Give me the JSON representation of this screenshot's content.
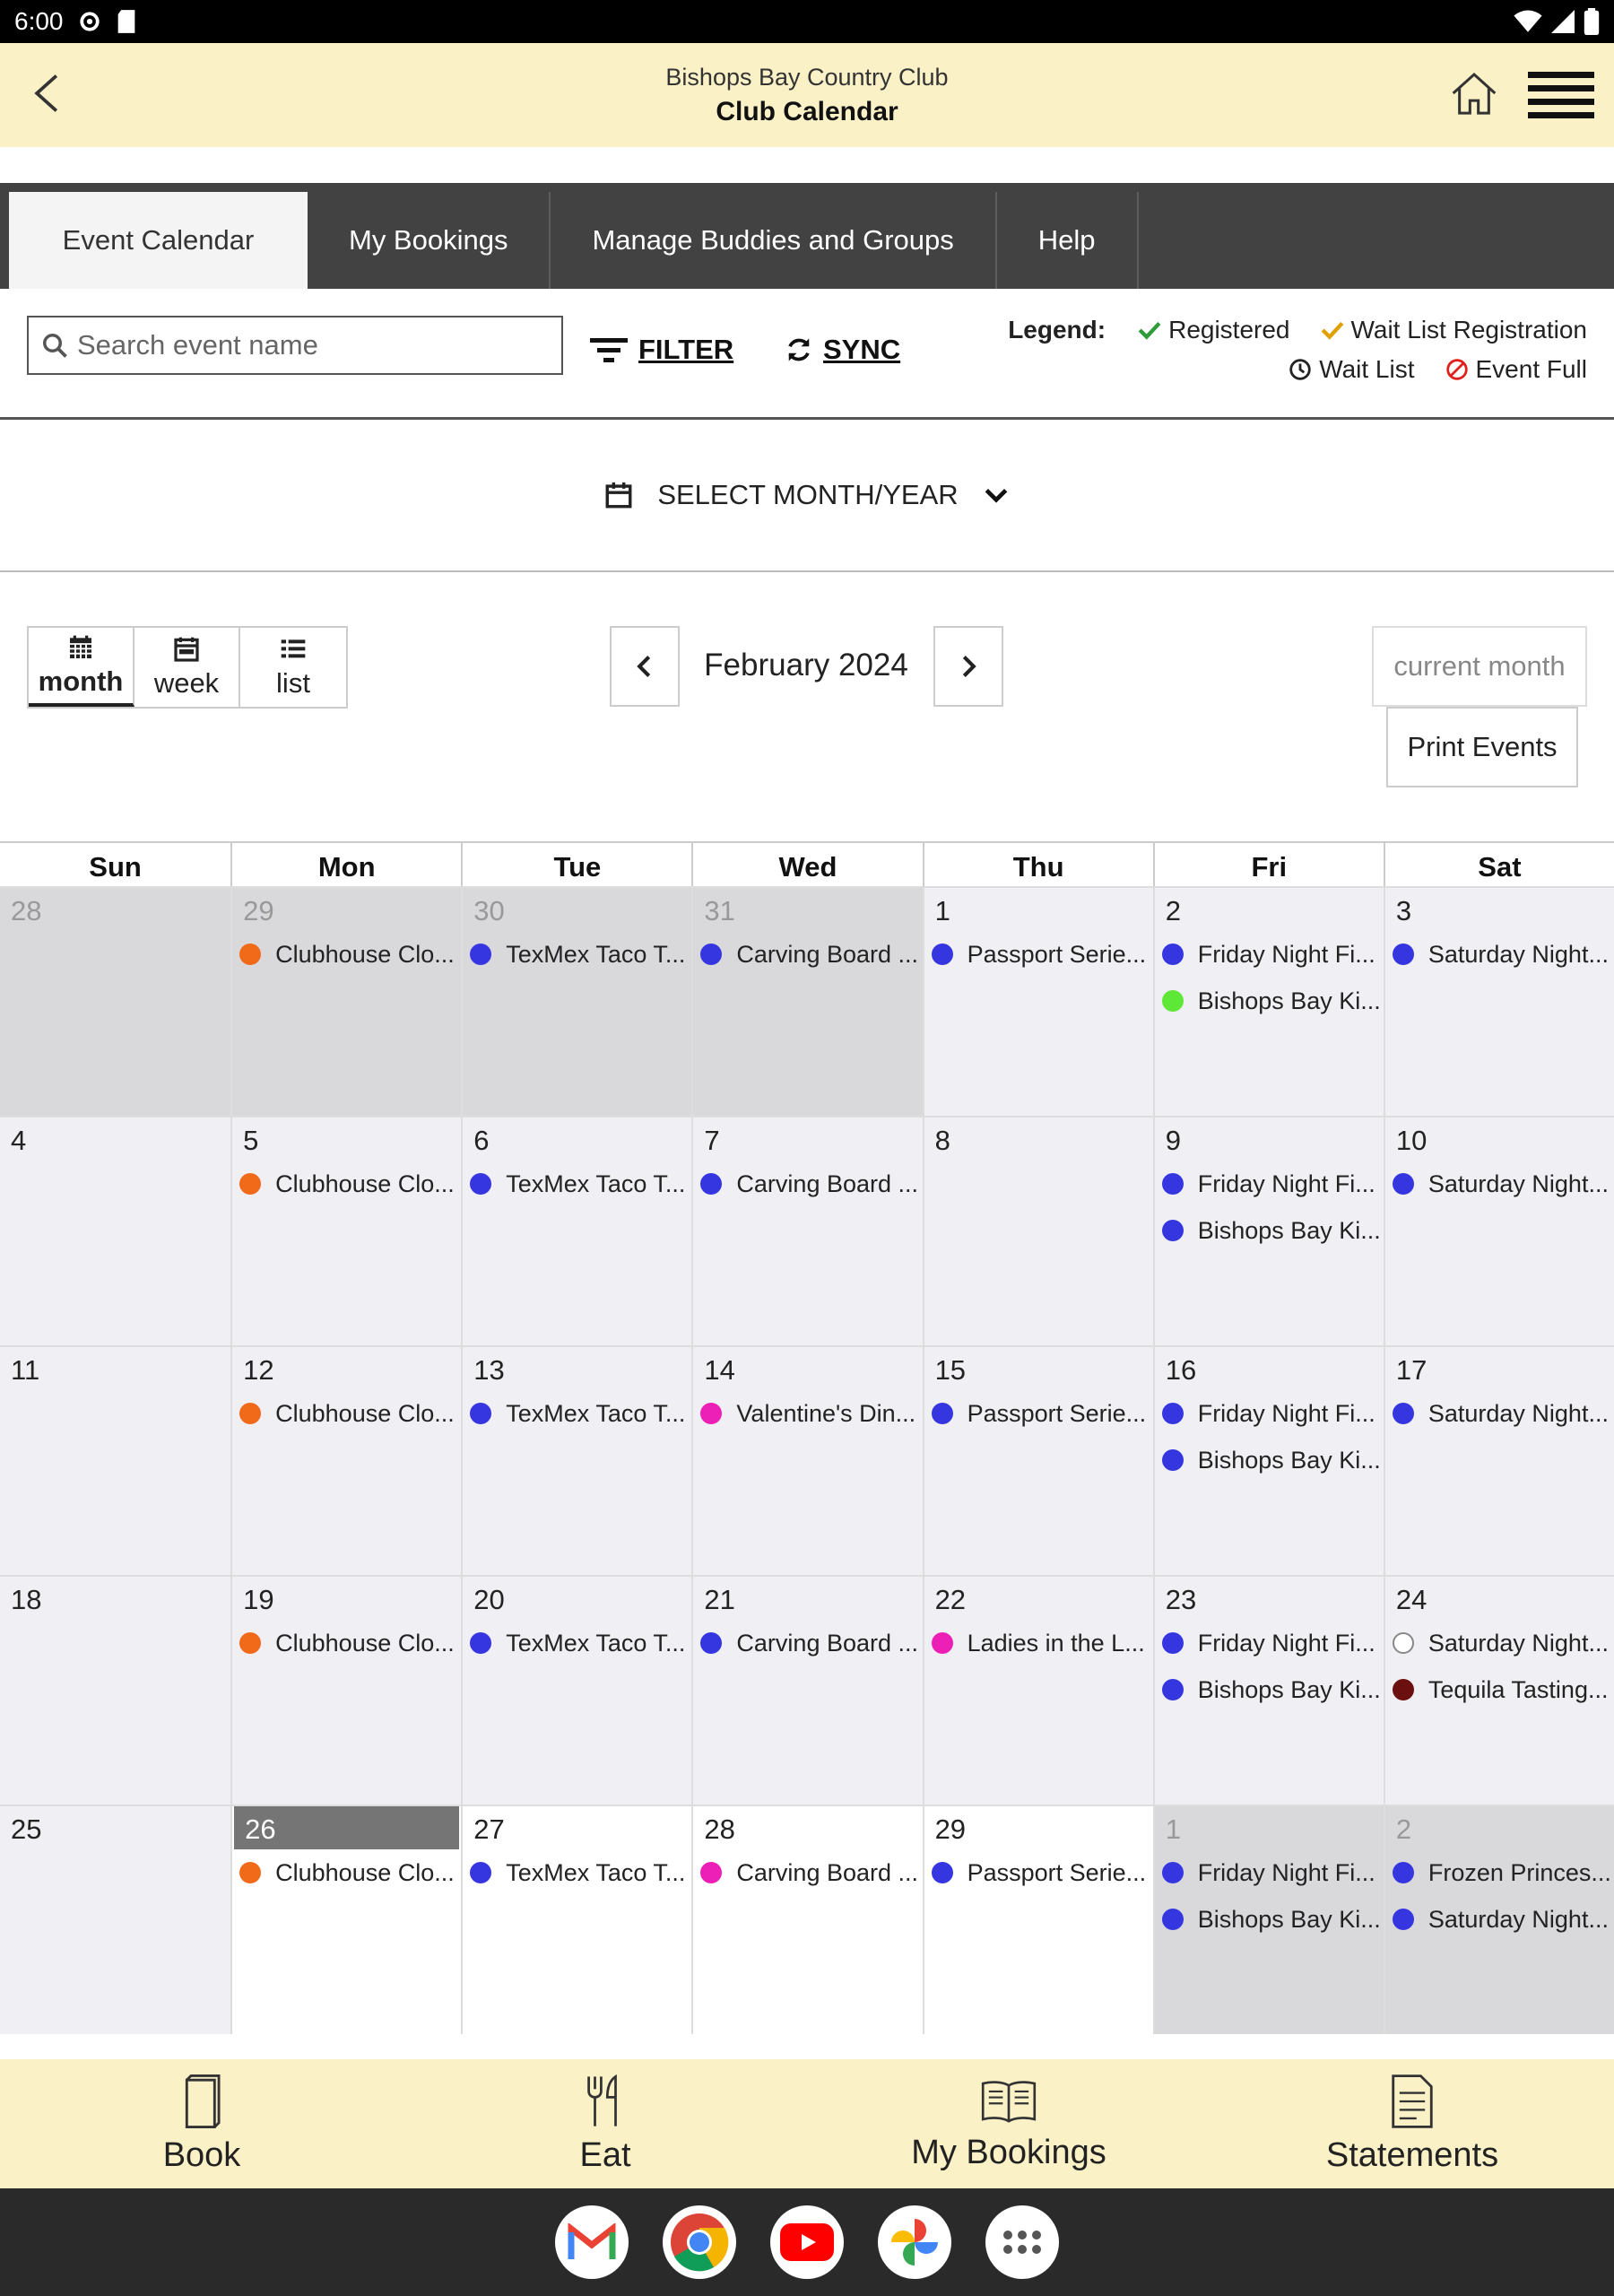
{
  "status": {
    "time": "6:00"
  },
  "header": {
    "club_name": "Bishops Bay Country Club",
    "title": "Club Calendar"
  },
  "tabs": [
    {
      "label": "Event Calendar",
      "active": true
    },
    {
      "label": "My Bookings"
    },
    {
      "label": "Manage Buddies and Groups"
    },
    {
      "label": "Help"
    }
  ],
  "search": {
    "placeholder": "Search event name"
  },
  "actions": {
    "filter": "FILTER",
    "sync": "SYNC"
  },
  "legend": {
    "label": "Legend:",
    "registered": "Registered",
    "wait_list_registration": "Wait List Registration",
    "wait_list": "Wait List",
    "event_full": "Event Full",
    "colors": {
      "registered": "#2e9c3a",
      "wait_list_registration": "#e0a000",
      "wait_list": "#222222",
      "event_full": "#e0201b"
    }
  },
  "month_select": {
    "label": "SELECT MONTH/YEAR"
  },
  "views": {
    "month": "month",
    "week": "week",
    "list": "list"
  },
  "calendar": {
    "month_label": "February 2024",
    "current_month": "current month",
    "print_events": "Print Events",
    "weekdays": [
      "Sun",
      "Mon",
      "Tue",
      "Wed",
      "Thu",
      "Fri",
      "Sat"
    ],
    "colors": {
      "blue": "#3636e0",
      "orange": "#f06a1a",
      "pink": "#ec1fb6",
      "green": "#5de838",
      "darkred": "#6b0f0f",
      "hollow": "#ffffff"
    },
    "days": [
      {
        "num": "28",
        "state": "other",
        "events": []
      },
      {
        "num": "29",
        "state": "other",
        "events": [
          {
            "title": "Clubhouse Clo...",
            "color": "orange"
          }
        ]
      },
      {
        "num": "30",
        "state": "other",
        "events": [
          {
            "title": "TexMex Taco T...",
            "color": "blue"
          }
        ]
      },
      {
        "num": "31",
        "state": "other",
        "events": [
          {
            "title": "Carving Board ...",
            "color": "blue"
          }
        ]
      },
      {
        "num": "1",
        "state": "",
        "events": [
          {
            "title": "Passport Serie...",
            "color": "blue"
          }
        ]
      },
      {
        "num": "2",
        "state": "",
        "events": [
          {
            "title": "Friday Night Fi...",
            "color": "blue"
          },
          {
            "title": "Bishops Bay Ki...",
            "color": "green"
          }
        ]
      },
      {
        "num": "3",
        "state": "",
        "events": [
          {
            "title": "Saturday Night...",
            "color": "blue"
          }
        ]
      },
      {
        "num": "4",
        "state": "",
        "events": []
      },
      {
        "num": "5",
        "state": "",
        "events": [
          {
            "title": "Clubhouse Clo...",
            "color": "orange"
          }
        ]
      },
      {
        "num": "6",
        "state": "",
        "events": [
          {
            "title": "TexMex Taco T...",
            "color": "blue"
          }
        ]
      },
      {
        "num": "7",
        "state": "",
        "events": [
          {
            "title": "Carving Board ...",
            "color": "blue"
          }
        ]
      },
      {
        "num": "8",
        "state": "",
        "events": []
      },
      {
        "num": "9",
        "state": "",
        "events": [
          {
            "title": "Friday Night Fi...",
            "color": "blue"
          },
          {
            "title": "Bishops Bay Ki...",
            "color": "blue"
          }
        ]
      },
      {
        "num": "10",
        "state": "",
        "events": [
          {
            "title": "Saturday Night...",
            "color": "blue"
          }
        ]
      },
      {
        "num": "11",
        "state": "",
        "events": []
      },
      {
        "num": "12",
        "state": "",
        "events": [
          {
            "title": "Clubhouse Clo...",
            "color": "orange"
          }
        ]
      },
      {
        "num": "13",
        "state": "",
        "events": [
          {
            "title": "TexMex Taco T...",
            "color": "blue"
          }
        ]
      },
      {
        "num": "14",
        "state": "",
        "events": [
          {
            "title": "Valentine's Din...",
            "color": "pink"
          }
        ]
      },
      {
        "num": "15",
        "state": "",
        "events": [
          {
            "title": "Passport Serie...",
            "color": "blue"
          }
        ]
      },
      {
        "num": "16",
        "state": "",
        "events": [
          {
            "title": "Friday Night Fi...",
            "color": "blue"
          },
          {
            "title": "Bishops Bay Ki...",
            "color": "blue"
          }
        ]
      },
      {
        "num": "17",
        "state": "",
        "events": [
          {
            "title": "Saturday Night...",
            "color": "blue"
          }
        ]
      },
      {
        "num": "18",
        "state": "",
        "events": []
      },
      {
        "num": "19",
        "state": "",
        "events": [
          {
            "title": "Clubhouse Clo...",
            "color": "orange"
          }
        ]
      },
      {
        "num": "20",
        "state": "",
        "events": [
          {
            "title": "TexMex Taco T...",
            "color": "blue"
          }
        ]
      },
      {
        "num": "21",
        "state": "",
        "events": [
          {
            "title": "Carving Board ...",
            "color": "blue"
          }
        ]
      },
      {
        "num": "22",
        "state": "",
        "events": [
          {
            "title": "Ladies in the L...",
            "color": "pink"
          }
        ]
      },
      {
        "num": "23",
        "state": "",
        "events": [
          {
            "title": "Friday Night Fi...",
            "color": "blue"
          },
          {
            "title": "Bishops Bay Ki...",
            "color": "blue"
          }
        ]
      },
      {
        "num": "24",
        "state": "",
        "events": [
          {
            "title": "Saturday Night...",
            "color": "hollow"
          },
          {
            "title": "Tequila Tasting...",
            "color": "darkred"
          }
        ]
      },
      {
        "num": "25",
        "state": "",
        "events": []
      },
      {
        "num": "26",
        "state": "today future",
        "events": [
          {
            "title": "Clubhouse Clo...",
            "color": "orange"
          }
        ]
      },
      {
        "num": "27",
        "state": "future",
        "events": [
          {
            "title": "TexMex Taco T...",
            "color": "blue"
          }
        ]
      },
      {
        "num": "28",
        "state": "future",
        "events": [
          {
            "title": "Carving Board ...",
            "color": "pink"
          }
        ]
      },
      {
        "num": "29",
        "state": "future",
        "events": [
          {
            "title": "Passport Serie...",
            "color": "blue"
          }
        ]
      },
      {
        "num": "1",
        "state": "other",
        "events": [
          {
            "title": "Friday Night Fi...",
            "color": "blue"
          },
          {
            "title": "Bishops Bay Ki...",
            "color": "blue"
          }
        ]
      },
      {
        "num": "2",
        "state": "other",
        "events": [
          {
            "title": "Frozen Princes...",
            "color": "blue"
          },
          {
            "title": "Saturday Night...",
            "color": "blue"
          }
        ]
      }
    ]
  },
  "bottom_nav": [
    {
      "label": "Book",
      "icon": "book-icon"
    },
    {
      "label": "Eat",
      "icon": "utensils-icon"
    },
    {
      "label": "My Bookings",
      "icon": "open-book-icon"
    },
    {
      "label": "Statements",
      "icon": "document-icon"
    }
  ],
  "dock": [
    "gmail-icon",
    "chrome-icon",
    "youtube-icon",
    "photos-icon",
    "apps-icon"
  ]
}
